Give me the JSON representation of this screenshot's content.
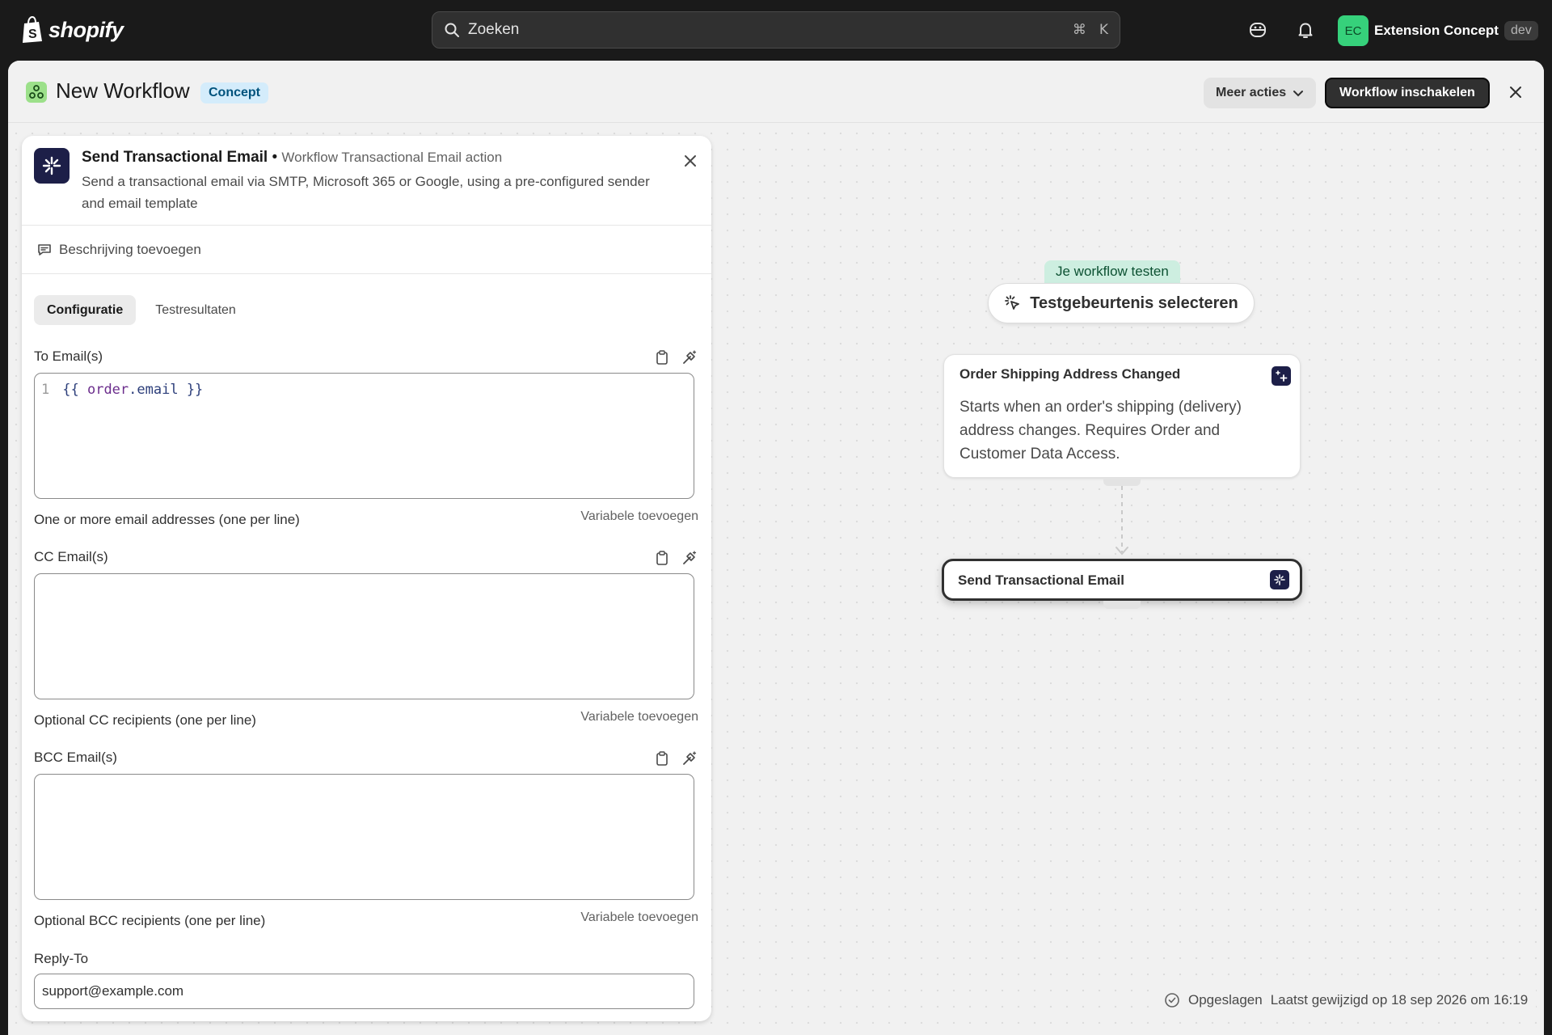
{
  "topbar": {
    "logo_text": "shopify",
    "search_placeholder": "Zoeken",
    "shortcut_cmd": "⌘",
    "shortcut_key": "K",
    "avatar_initials": "EC",
    "account_name": "Extension Concept",
    "env_badge": "dev"
  },
  "header": {
    "title": "New Workflow",
    "status_badge": "Concept",
    "more_actions_label": "Meer acties",
    "enable_label": "Workflow inschakelen"
  },
  "panel": {
    "action_title": "Send Transactional Email",
    "separator": "•",
    "action_subtitle": "Workflow Transactional Email action",
    "action_description": "Send a transactional email via SMTP, Microsoft 365 or Google, using a pre-configured sender and email template",
    "add_description": "Beschrijving toevoegen",
    "tabs": [
      {
        "label": "Configuratie",
        "active": true
      },
      {
        "label": "Testresultaten",
        "active": false
      }
    ],
    "fields": {
      "to": {
        "label": "To Email(s)",
        "line_number": "1",
        "code_open": "{{ ",
        "code_var": "order",
        "code_dot": ".email",
        "code_close": " }}",
        "help": "One or more email addresses (one per line)",
        "add_variable": "Variabele toevoegen"
      },
      "cc": {
        "label": "CC Email(s)",
        "help": "Optional CC recipients (one per line)",
        "add_variable": "Variabele toevoegen"
      },
      "bcc": {
        "label": "BCC Email(s)",
        "help": "Optional BCC recipients (one per line)",
        "add_variable": "Variabele toevoegen"
      },
      "reply_to": {
        "label": "Reply-To",
        "value": "support@example.com"
      }
    }
  },
  "canvas": {
    "test_badge": "Je workflow testen",
    "test_button": "Testgebeurtenis selecteren",
    "trigger": {
      "title": "Order Shipping Address Changed",
      "description": "Starts when an order's shipping (delivery) address changes. Requires Order and Customer Data Access."
    },
    "action": {
      "title": "Send Transactional Email"
    }
  },
  "status": {
    "saved_label": "Opgeslagen",
    "last_modified": "Laatst gewijzigd op 18 sep 2026 om 16:19"
  },
  "colors": {
    "accent_dark": "#303030",
    "action_icon_bg": "#1d1f48",
    "concept_badge_bg": "#d4ecfb",
    "test_badge_bg": "#cdeee0",
    "avatar_bg": "#36d17b"
  }
}
